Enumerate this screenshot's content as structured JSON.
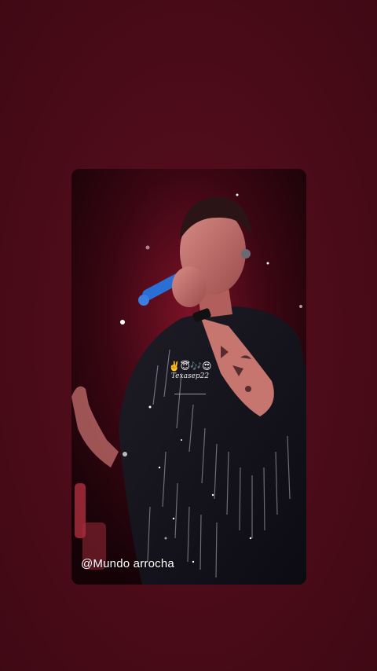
{
  "background_color": "#4a0b18",
  "story": {
    "sticker": {
      "emojis": "✌️😇🎶😍",
      "signature": "Texasep22"
    },
    "watermark": "@Mundo arrocha",
    "microphone_color": "#2a6fd6"
  }
}
